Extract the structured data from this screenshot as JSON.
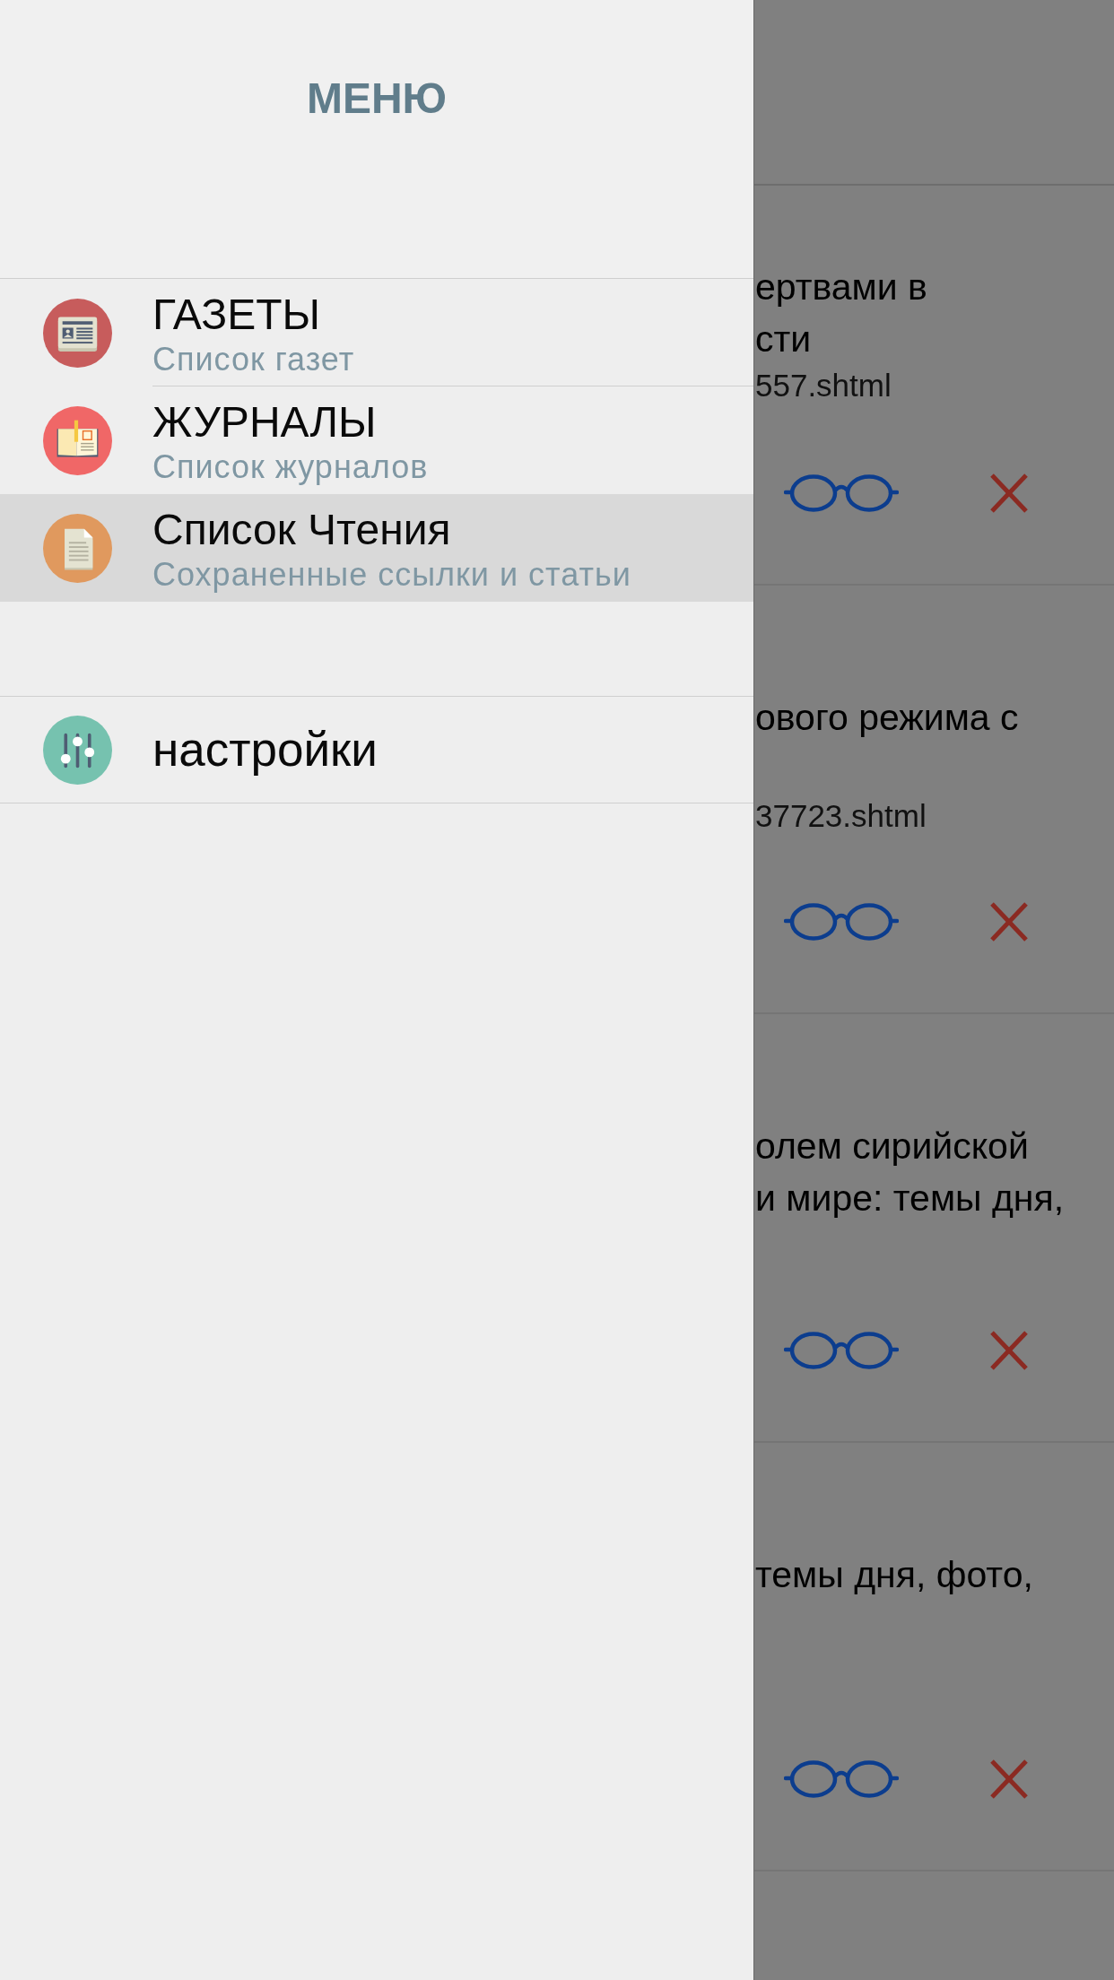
{
  "drawer": {
    "title": "МЕНЮ",
    "items": [
      {
        "title": "ГАЗЕТЫ",
        "subtitle": "Список газет",
        "selected": false
      },
      {
        "title": "ЖУРНАЛЫ",
        "subtitle": "Список журналов",
        "selected": false
      },
      {
        "title": "Список Чтения",
        "subtitle": "Сохраненные ссылки и статьи",
        "selected": true
      }
    ],
    "footer_items": [
      {
        "label": "настройки",
        "selected": false
      }
    ]
  },
  "reading_list": {
    "cards": [
      {
        "title_lines": [
          "ертвами в",
          "сти"
        ],
        "url": "557.shtml"
      },
      {
        "title_lines": [
          "ового режима с"
        ],
        "url": "37723.shtml"
      },
      {
        "title_lines": [
          "олем сирийской",
          "и мире: темы дня,"
        ]
      },
      {
        "title_lines": [
          "темы дня, фото,"
        ]
      }
    ]
  }
}
